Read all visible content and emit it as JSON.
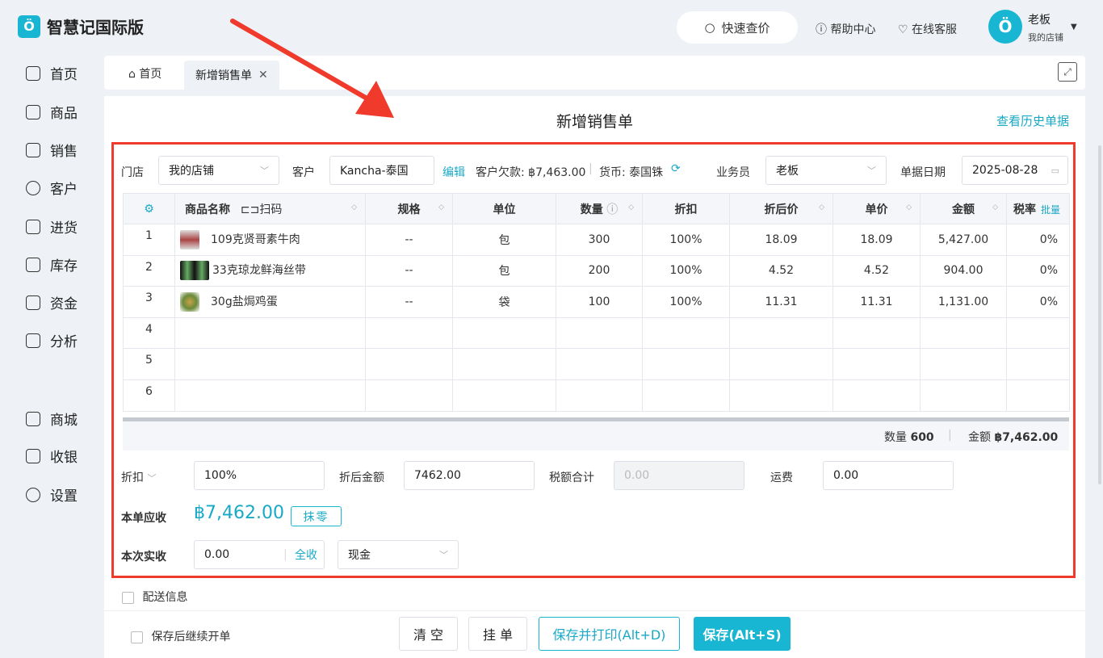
{
  "app": {
    "name": "智慧记国际版",
    "logo_glyph": "Ö"
  },
  "header": {
    "quick_price": "快速查价",
    "help": "帮助中心",
    "service": "在线客服",
    "user_name": "老板",
    "user_store": "我的店铺"
  },
  "sidebar": {
    "items": [
      {
        "label": "首页"
      },
      {
        "label": "商品"
      },
      {
        "label": "销售"
      },
      {
        "label": "客户"
      },
      {
        "label": "进货"
      },
      {
        "label": "库存"
      },
      {
        "label": "资金"
      },
      {
        "label": "分析"
      },
      {
        "label": "商城"
      },
      {
        "label": "收银"
      },
      {
        "label": "设置"
      }
    ]
  },
  "tabs": {
    "home": "首页",
    "active": "新增销售单"
  },
  "page": {
    "title": "新增销售单",
    "history_link": "查看历史单据"
  },
  "form": {
    "store_label": "门店",
    "store_value": "我的店铺",
    "customer_label": "客户",
    "customer_value": "Kancha-泰国",
    "edit_link": "编辑",
    "debt_text": "客户欠款: ฿7,463.00",
    "currency_text": "货币: 泰国铢",
    "salesman_label": "业务员",
    "salesman_value": "老板",
    "date_label": "单据日期",
    "date_value": "2025-08-28"
  },
  "table": {
    "headers": {
      "name": "商品名称",
      "scan": "扫码",
      "spec": "规格",
      "unit": "单位",
      "qty": "数量",
      "discount": "折扣",
      "discounted_price": "折后价",
      "price": "单价",
      "amount": "金额",
      "tax": "税率",
      "batch": "批量"
    },
    "rows": [
      {
        "idx": "1",
        "name": "109克贤哥素牛肉",
        "spec": "--",
        "unit": "包",
        "qty": "300",
        "discount": "100%",
        "dprice": "18.09",
        "price": "18.09",
        "amount": "5,427.00",
        "tax": "0%"
      },
      {
        "idx": "2",
        "name": "33克琼龙鲜海丝带",
        "spec": "--",
        "unit": "包",
        "qty": "200",
        "discount": "100%",
        "dprice": "4.52",
        "price": "4.52",
        "amount": "904.00",
        "tax": "0%"
      },
      {
        "idx": "3",
        "name": "30g盐焗鸡蛋",
        "spec": "--",
        "unit": "袋",
        "qty": "100",
        "discount": "100%",
        "dprice": "11.31",
        "price": "11.31",
        "amount": "1,131.00",
        "tax": "0%"
      },
      {
        "idx": "4"
      },
      {
        "idx": "5"
      },
      {
        "idx": "6"
      }
    ],
    "summary_qty_label": "数量",
    "summary_qty": "600",
    "summary_amount_label": "金额",
    "summary_amount": "฿7,462.00"
  },
  "totals": {
    "discount_label": "折扣",
    "discount_value": "100%",
    "discounted_amount_label": "折后金额",
    "discounted_amount_value": "7462.00",
    "tax_total_label": "税额合计",
    "tax_total_placeholder": "0.00",
    "freight_label": "运费",
    "freight_value": "0.00",
    "receivable_label": "本单应收",
    "receivable_value": "฿7,462.00",
    "round_button": "抹零",
    "received_label": "本次实收",
    "received_value": "0.00",
    "full_button": "全收",
    "payment_method": "现金"
  },
  "delivery_label": "配送信息",
  "footer": {
    "continue_label": "保存后继续开单",
    "clear": "清 空",
    "hold": "挂 单",
    "save_print": "保存并打印(Alt+D)",
    "save": "保存(Alt+S)"
  },
  "colors": {
    "accent": "#19b6d3",
    "highlight_border": "#ef3a2c"
  }
}
